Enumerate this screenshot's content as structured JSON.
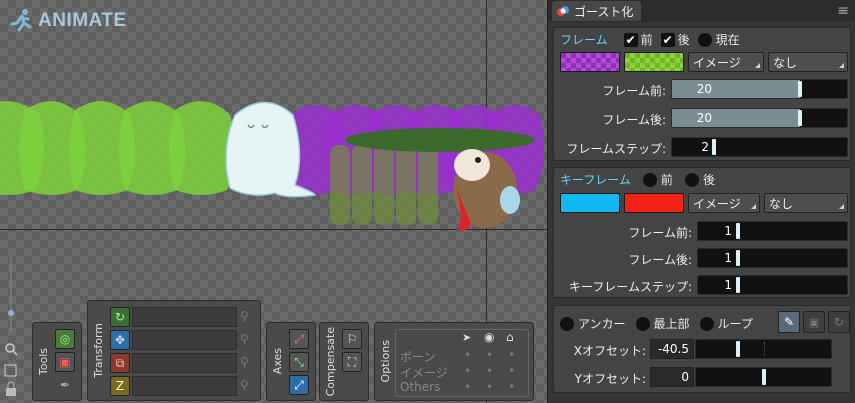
{
  "app": {
    "logo_text": "ANIMATE"
  },
  "toolbar": {
    "tools_label": "Tools",
    "transform_label": "Transform",
    "axes_label": "Axes",
    "compensate_label": "Compensate",
    "options_label": "Options",
    "options_rows": [
      "ボーン",
      "イメージ",
      "Others"
    ]
  },
  "panel": {
    "title": "ゴースト化",
    "frames": {
      "header": "フレーム",
      "before_label": "前",
      "after_label": "後",
      "current_label": "現在",
      "before_checked": true,
      "after_checked": true,
      "current_checked": false,
      "before_color": "#b24bd6",
      "after_color": "#8fd13a",
      "image_dropdown": "イメージ",
      "blend_dropdown": "なし",
      "frames_before_label": "フレーム前:",
      "frames_before": "20",
      "frames_before_fraction": 0.62,
      "frames_after_label": "フレーム後:",
      "frames_after": "20",
      "frames_after_fraction": 0.62,
      "frame_step_label": "フレームステップ:",
      "frame_step": "2",
      "frame_step_fraction": 0.1
    },
    "keyframes": {
      "header": "キーフレーム",
      "before_label": "前",
      "after_label": "後",
      "before_color": "#12b8f0",
      "after_color": "#ef2214",
      "image_dropdown": "イメージ",
      "blend_dropdown": "なし",
      "frames_before_label": "フレーム前:",
      "frames_before": "1",
      "frames_after_label": "フレーム後:",
      "frames_after": "1",
      "frame_step_label": "キーフレームステップ:",
      "frame_step": "1"
    },
    "anchor": {
      "anchor_label": "アンカー",
      "topmost_label": "最上部",
      "loop_label": "ループ",
      "x_offset_label": "Xオフセット:",
      "x_offset": "-40.5",
      "y_offset_label": "Yオフセット:",
      "y_offset": "0"
    }
  }
}
